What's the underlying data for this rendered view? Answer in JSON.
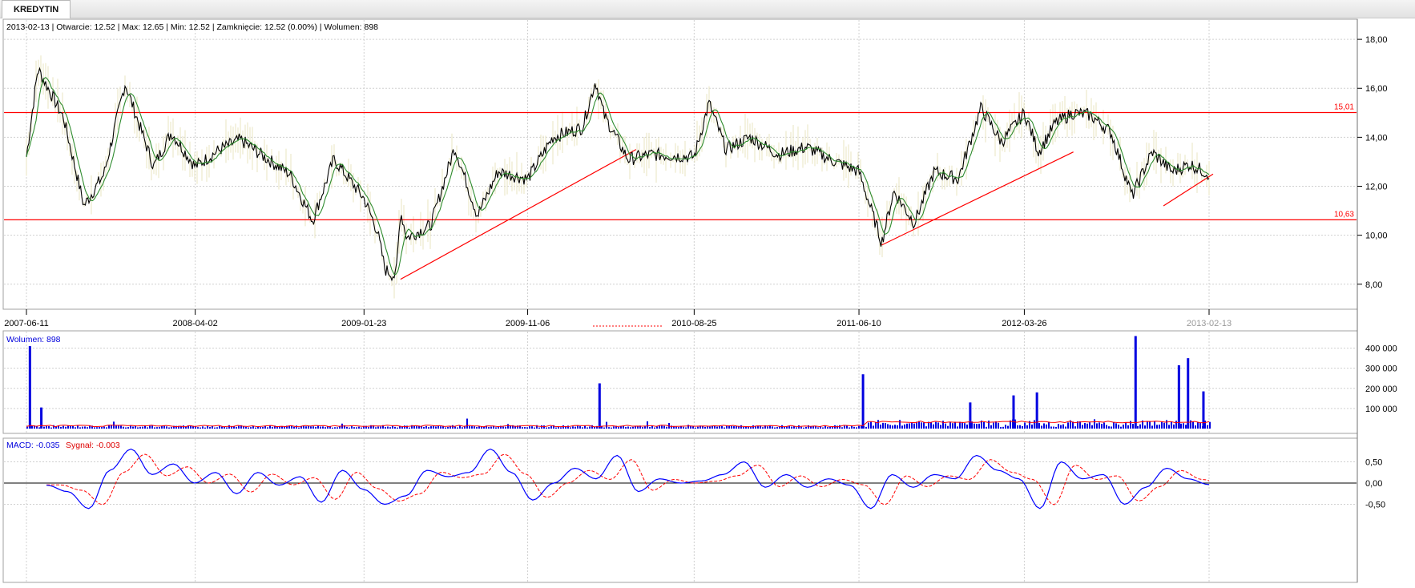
{
  "tabs": [
    {
      "label": "KREDYTIN"
    }
  ],
  "info_line": "2013-02-13 | Otwarcie: 12.52 | Max: 12.65 | Min: 12.52 | Zamknięcie: 12.52 (0.00%)  | Wolumen: 898",
  "volume_label": "Wolumen: 898",
  "macd_label": "MACD: -0.035",
  "signal_label": "Sygnał: -0.003",
  "colors": {
    "price": "#000000",
    "sma": "#2e8b2e",
    "wick": "#e8e4c0",
    "level": "#ff0000",
    "volume": "#0000e0",
    "volume_avg": "#ff0000",
    "macd": "#0000ff",
    "signal": "#ff0000"
  },
  "chart_data": [
    {
      "type": "line",
      "series": [
        {
          "values_key": "price"
        },
        {
          "values_key": "moving-average"
        }
      ],
      "x": [
        "2007-06-11",
        "2007-07-01",
        "2007-08-15",
        "2007-09-20",
        "2007-10-25",
        "2007-12-01",
        "2008-01-20",
        "2008-02-20",
        "2008-04-02",
        "2008-05-15",
        "2008-06-20",
        "2008-08-01",
        "2008-09-15",
        "2008-10-25",
        "2008-12-01",
        "2009-01-23",
        "2009-02-15",
        "2009-03-01",
        "2009-03-20",
        "2009-03-28",
        "2009-04-08",
        "2009-05-20",
        "2009-07-01",
        "2009-08-10",
        "2009-09-15",
        "2009-11-06",
        "2009-12-20",
        "2010-02-10",
        "2010-03-05",
        "2010-03-20",
        "2010-05-01",
        "2010-06-10",
        "2010-08-25",
        "2010-09-20",
        "2010-10-20",
        "2010-12-01",
        "2011-01-20",
        "2011-03-10",
        "2011-04-20",
        "2011-06-10",
        "2011-07-20",
        "2011-08-10",
        "2011-09-15",
        "2011-10-20",
        "2011-12-01",
        "2012-01-10",
        "2012-02-15",
        "2012-03-26",
        "2012-04-20",
        "2012-05-20",
        "2012-06-20",
        "2012-07-20",
        "2012-08-25",
        "2012-10-01",
        "2012-11-05",
        "2012-12-10",
        "2013-01-10",
        "2013-02-13"
      ],
      "price": [
        13.2,
        16.8,
        14.8,
        11.2,
        12.5,
        16.2,
        12.8,
        14.2,
        12.8,
        13.5,
        13.9,
        13.2,
        12.5,
        10.6,
        13.1,
        11.5,
        10.2,
        8.6,
        8.3,
        11.0,
        9.9,
        10.4,
        13.6,
        10.8,
        12.6,
        12.3,
        14.0,
        14.4,
        16.3,
        14.9,
        13.1,
        13.3,
        13.2,
        15.4,
        13.5,
        14.0,
        13.3,
        13.6,
        13.1,
        12.6,
        9.7,
        11.8,
        10.5,
        12.6,
        12.3,
        15.2,
        13.8,
        15.0,
        13.4,
        14.6,
        15.0,
        14.9,
        14.2,
        11.6,
        13.4,
        12.6,
        12.9,
        12.5
      ],
      "ylim": [
        7.6,
        18.2
      ],
      "yticks": [
        "18,00",
        "16,00",
        "14,00",
        "12,00",
        "10,00",
        "8,00"
      ],
      "xticks": [
        "2007-06-11",
        "2008-04-02",
        "2009-01-23",
        "2009-11-06",
        "2010-08-25",
        "2011-06-10",
        "2012-03-26",
        "2013-02-13"
      ],
      "annotations": [
        {
          "label": "15,01",
          "y": 15.01
        },
        {
          "label": "10,63",
          "y": 10.63
        }
      ],
      "trendlines": [
        {
          "from": [
            "2009-03-28",
            8.2
          ],
          "to": [
            "2010-05-15",
            13.5
          ]
        },
        {
          "from": [
            "2011-07-20",
            9.6
          ],
          "to": [
            "2012-06-20",
            13.4
          ]
        },
        {
          "from": [
            "2012-11-25",
            11.2
          ],
          "to": [
            "2013-02-20",
            12.5
          ]
        }
      ],
      "grid": true
    },
    {
      "type": "bar",
      "title": "Wolumen",
      "ylim": [
        0,
        470000
      ],
      "yticks": [
        "400 000",
        "300 000",
        "200 000",
        "100 000"
      ],
      "spikes": [
        {
          "x": "2007-06-15",
          "v": 410000
        },
        {
          "x": "2007-07-05",
          "v": 105000
        },
        {
          "x": "2010-03-10",
          "v": 225000
        },
        {
          "x": "2011-06-15",
          "v": 270000
        },
        {
          "x": "2011-12-20",
          "v": 130000
        },
        {
          "x": "2012-03-05",
          "v": 165000
        },
        {
          "x": "2012-04-15",
          "v": 180000
        },
        {
          "x": "2012-10-05",
          "v": 460000
        },
        {
          "x": "2012-12-20",
          "v": 315000
        },
        {
          "x": "2013-01-05",
          "v": 350000
        },
        {
          "x": "2013-02-01",
          "v": 185000
        }
      ]
    },
    {
      "type": "line",
      "series": [
        {
          "name": "MACD"
        },
        {
          "name": "Sygnał"
        }
      ],
      "ylim": [
        -0.75,
        0.85
      ],
      "yticks": [
        "0,50",
        "0,00",
        "-0,50"
      ],
      "macd": [
        -0.05,
        -0.2,
        -0.6,
        0.3,
        0.8,
        0.2,
        0.45,
        0.0,
        0.25,
        -0.25,
        0.25,
        -0.05,
        0.15,
        -0.45,
        0.3,
        -0.15,
        -0.5,
        -0.3,
        0.3,
        0.15,
        0.25,
        0.8,
        0.25,
        -0.4,
        0.0,
        0.35,
        0.1,
        0.65,
        -0.2,
        0.1,
        0.0,
        0.05,
        0.2,
        0.5,
        -0.1,
        0.2,
        -0.1,
        0.1,
        -0.05,
        -0.6,
        0.2,
        -0.1,
        0.2,
        0.1,
        0.65,
        0.3,
        0.1,
        -0.6,
        0.5,
        0.1,
        0.2,
        -0.5,
        -0.1,
        0.35,
        0.1,
        -0.035
      ]
    }
  ]
}
